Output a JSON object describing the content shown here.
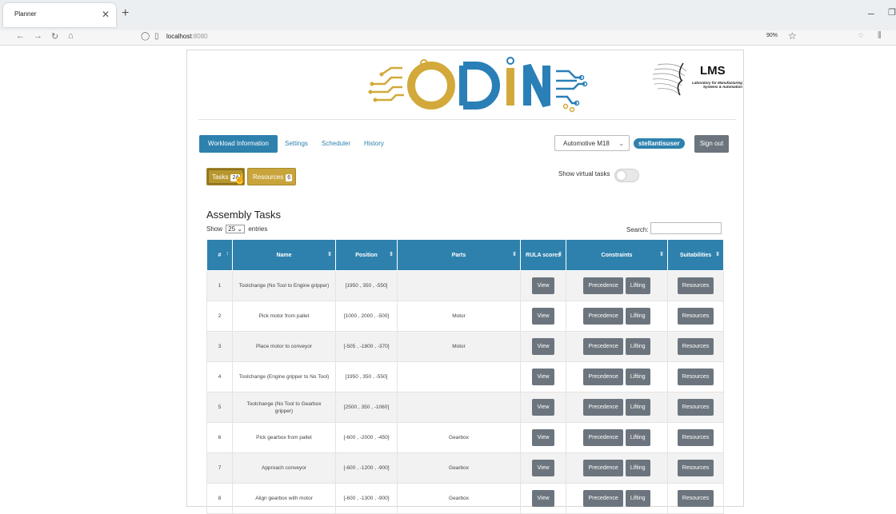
{
  "browser": {
    "tab_title": "Planner",
    "url_host": "localhost",
    "url_port": ":8080",
    "zoom": "90%"
  },
  "logos": {
    "main": "ODIN",
    "lms_title": "LMS",
    "lms_subtitle": "Laboratory for Manufacturing Systems & Automation"
  },
  "colors": {
    "accent": "#2e81ad",
    "tasks_button": "#c9a43c",
    "grey_button": "#6c757d",
    "odin_gold": "#d2a93a",
    "odin_blue": "#2a7fb7"
  },
  "nav": {
    "workload": "Workload Information",
    "settings": "Settings",
    "scheduler": "Scheduler",
    "history": "History"
  },
  "header_right": {
    "workspace": "Automotive M18",
    "user": "stellantisuser",
    "signout": "Sign out"
  },
  "buttons": {
    "tasks": "Tasks",
    "tasks_count": "24",
    "resources": "Resources",
    "resources_count": "6"
  },
  "virtual_tasks": {
    "label": "Show virtual tasks",
    "enabled": false
  },
  "section": {
    "title": "Assembly Tasks",
    "show": "Show",
    "entries_value": "25",
    "entries": "entries",
    "search": "Search:"
  },
  "table": {
    "headers": [
      "#",
      "Name",
      "Position",
      "Parts",
      "RULA scores",
      "Constraints",
      "Suitabilities"
    ],
    "btn_view": "View",
    "btn_precedence": "Precedence",
    "btn_lifting": "Lifting",
    "btn_resources": "Resources",
    "rows": [
      {
        "id": "1",
        "name": "Toolchange (No Tool to Engine gripper)",
        "position": "[1950 , 350 , -550]",
        "parts": ""
      },
      {
        "id": "2",
        "name": "Pick motor from pallet",
        "position": "[1000 , 2000 , -500]",
        "parts": "Motor"
      },
      {
        "id": "3",
        "name": "Place motor to conveyor",
        "position": "[-505 , -1800 , -370]",
        "parts": "Motor"
      },
      {
        "id": "4",
        "name": "Toolchange (Engine gripper to No Tool)",
        "position": "[1950 , 350 , -550]",
        "parts": ""
      },
      {
        "id": "5",
        "name": "Toolchange (No Tool to Gearbox gripper)",
        "position": "[2500 , 350 , -1060]",
        "parts": ""
      },
      {
        "id": "6",
        "name": "Pick gearbox from pallet",
        "position": "[-600 , -2000 , -450]",
        "parts": "Gearbox"
      },
      {
        "id": "7",
        "name": "Approach conveyor",
        "position": "[-600 , -1200 , -900]",
        "parts": "Gearbox"
      },
      {
        "id": "8",
        "name": "Align gearbox with motor",
        "position": "[-600 , -1300 , -900]",
        "parts": "Gearbox"
      }
    ]
  }
}
